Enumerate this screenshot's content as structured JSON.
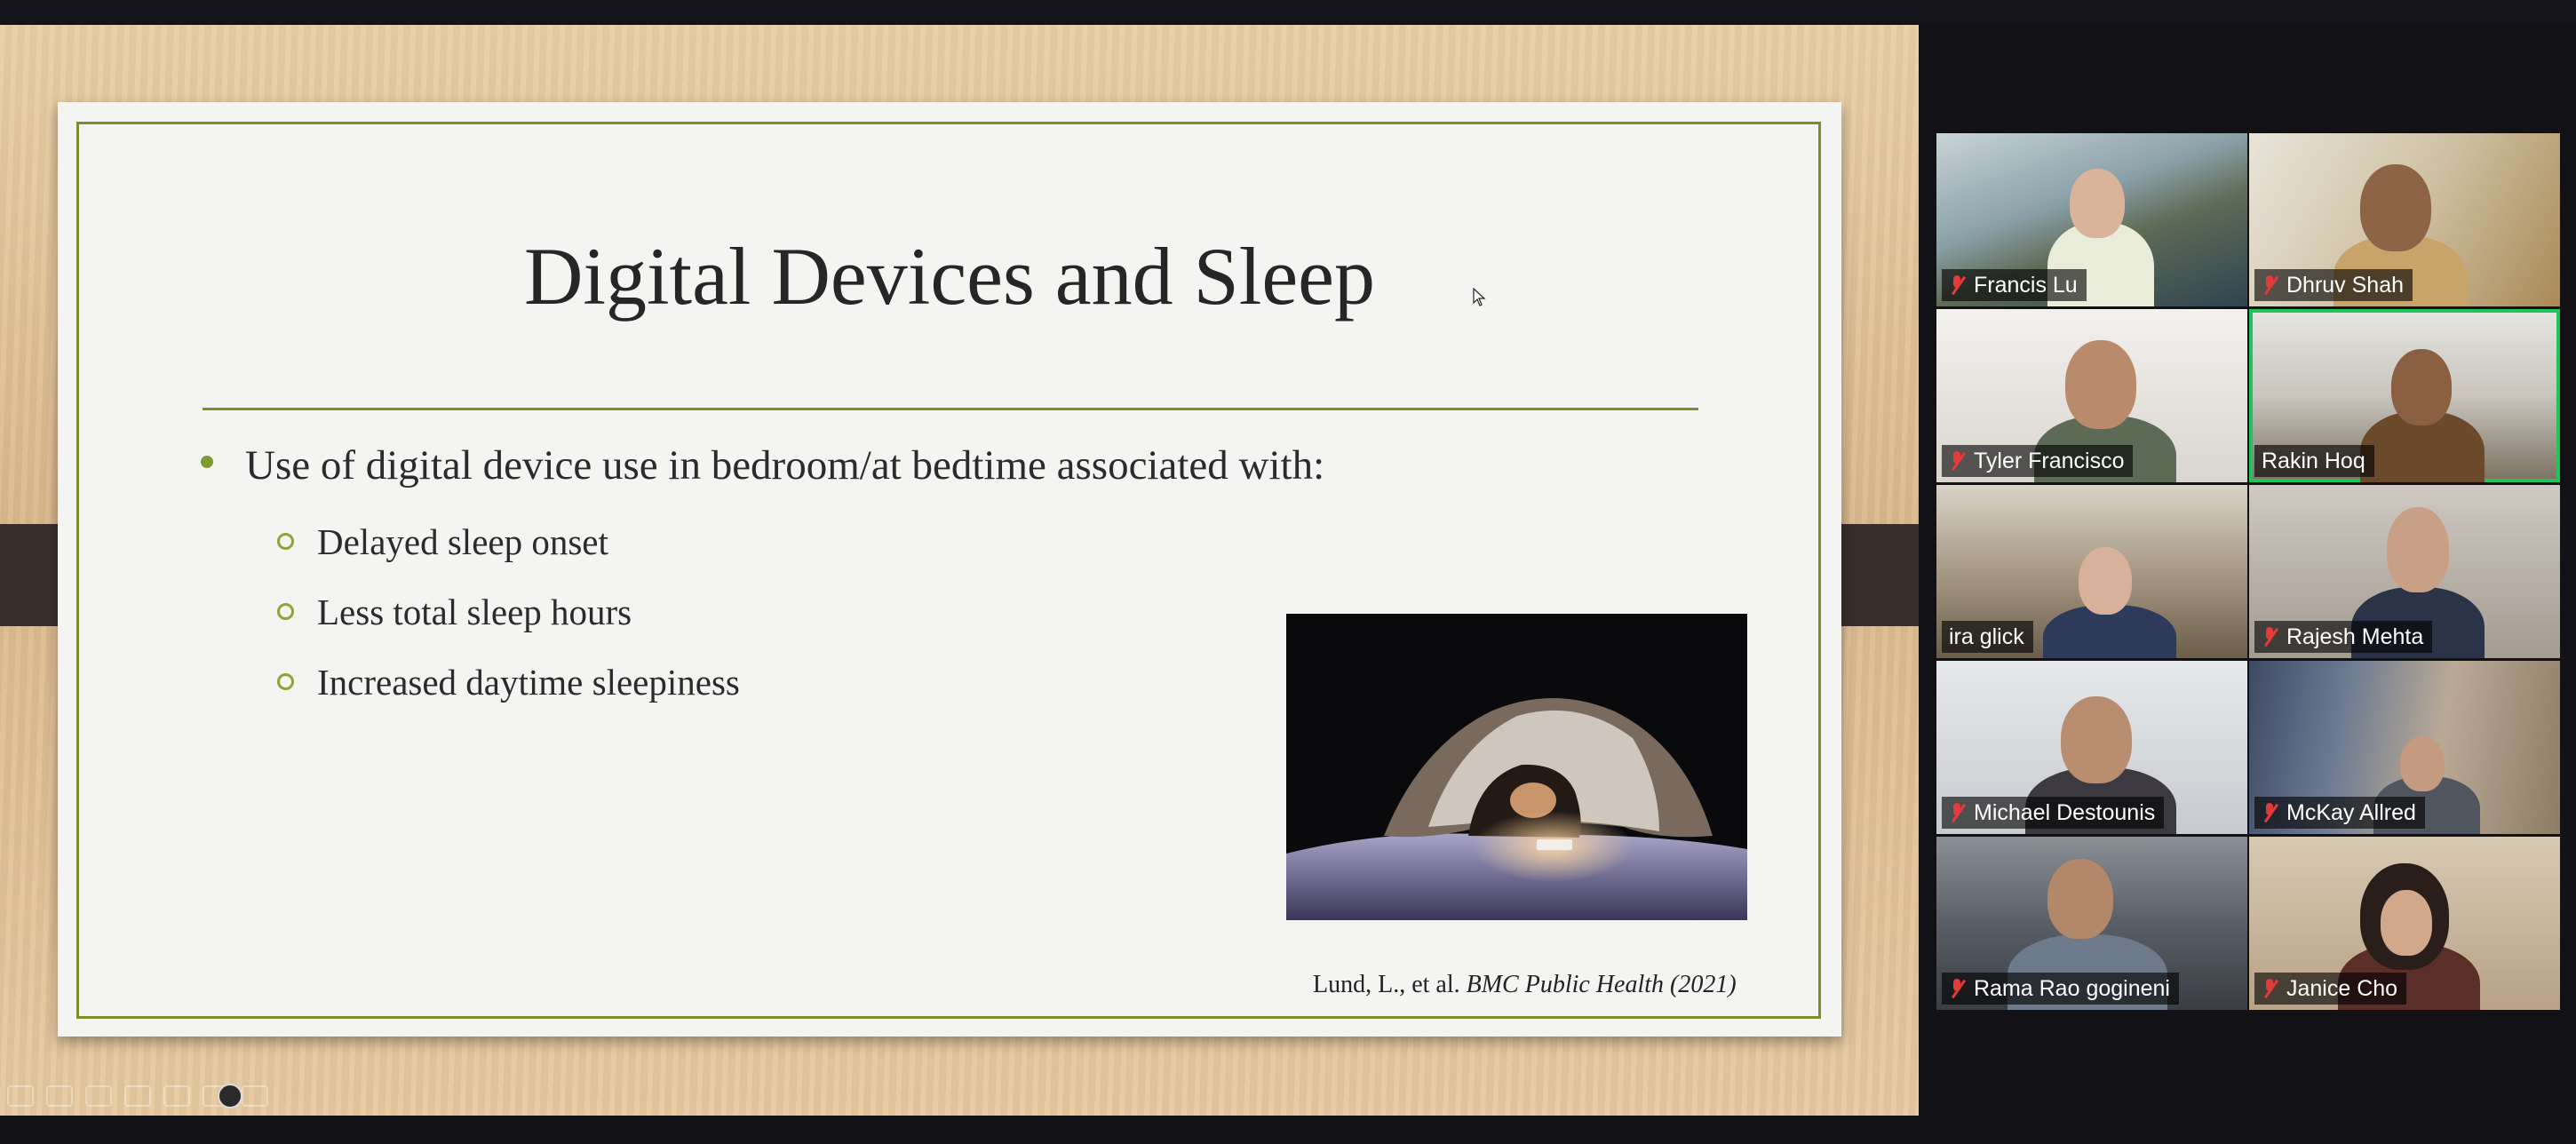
{
  "slide": {
    "title": "Digital Devices and Sleep",
    "bullet": "Use of digital device use in bedroom/at bedtime associated with:",
    "subbullets": [
      "Delayed sleep onset",
      "Less total sleep hours",
      "Increased daytime sleepiness"
    ],
    "citation_plain": "Lund, L., et al.",
    "citation_italic": "BMC Public Health (2021)"
  },
  "colors": {
    "accent": "#7f8c2c",
    "active_speaker": "#21c35a",
    "muted_mic": "#e23b3b"
  },
  "participants": [
    {
      "name": "Francis Lu",
      "muted": true
    },
    {
      "name": "Dhruv Shah",
      "muted": true
    },
    {
      "name": "Tyler Francisco",
      "muted": true
    },
    {
      "name": "Rakin Hoq",
      "muted": false,
      "active": true
    },
    {
      "name": "ira glick",
      "muted": false
    },
    {
      "name": "Rajesh Mehta",
      "muted": true
    },
    {
      "name": "Michael Destounis",
      "muted": true
    },
    {
      "name": "McKay Allred",
      "muted": true
    },
    {
      "name": "Rama Rao gogineni",
      "muted": true
    },
    {
      "name": "Janice Cho",
      "muted": true
    }
  ]
}
